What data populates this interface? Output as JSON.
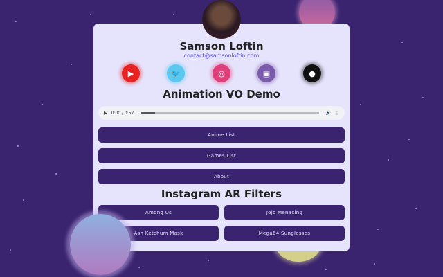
{
  "profile": {
    "name": "Samson Loftin",
    "email": "contact@samsonloftin.com"
  },
  "social": [
    {
      "icon": "youtube-icon",
      "glyph": "▶",
      "color": "#e62222"
    },
    {
      "icon": "twitter-icon",
      "glyph": "🐦",
      "color": "#5cc8f0"
    },
    {
      "icon": "instagram-icon",
      "glyph": "◎",
      "color": "#e0407a"
    },
    {
      "icon": "twitch-icon",
      "glyph": "▣",
      "color": "#7a5aaa"
    },
    {
      "icon": "github-icon",
      "glyph": "●",
      "color": "#111111"
    }
  ],
  "demo": {
    "heading": "Animation VO Demo",
    "time": "0:00 / 0:57",
    "progress": 0.08
  },
  "links": [
    "Anime List",
    "Games List",
    "About"
  ],
  "filters": {
    "heading": "Instagram AR Filters",
    "items": [
      "Among Us",
      "Jojo Menacing",
      "Ash Ketchum Mask",
      "Mega64 Sunglasses"
    ]
  },
  "colors": {
    "background": "#3a2470",
    "card": "#e6e4fc",
    "button": "#3a2470"
  }
}
